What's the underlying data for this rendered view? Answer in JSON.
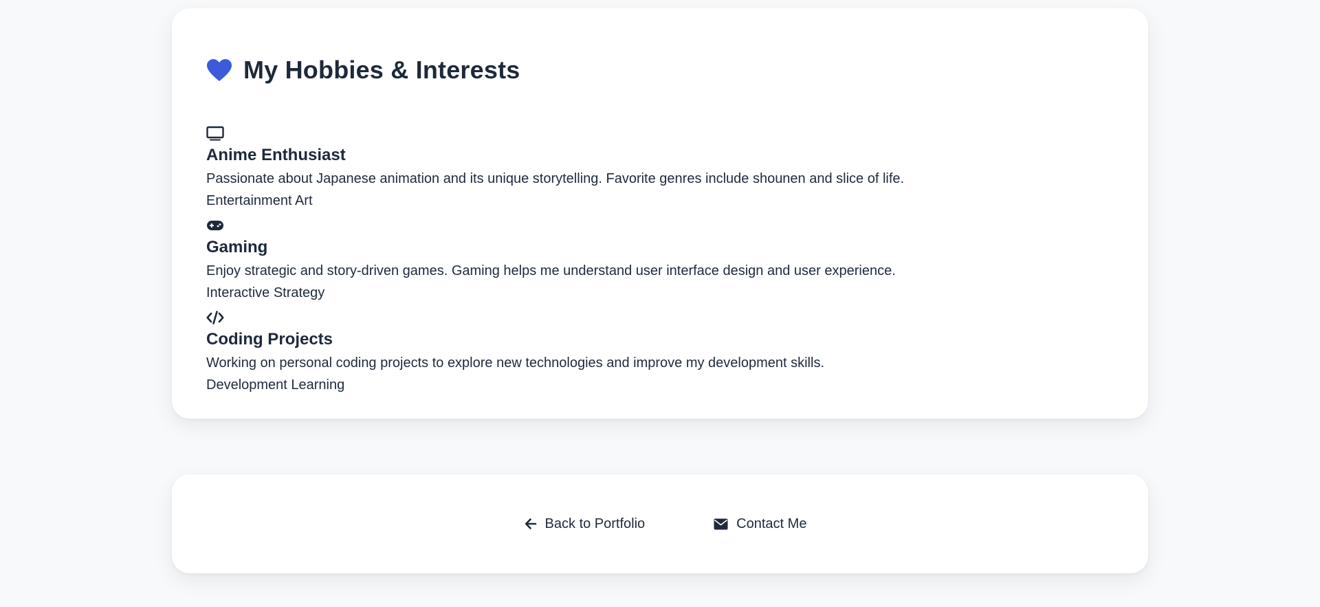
{
  "colors": {
    "accent": "#3b5bdb",
    "text": "#1e293b",
    "background": "#f8f9fb",
    "card": "#ffffff"
  },
  "hobbies_section": {
    "icon": "heart-icon",
    "title": "My Hobbies & Interests",
    "items": [
      {
        "icon": "tv-icon",
        "title": "Anime Enthusiast",
        "description": "Passionate about Japanese animation and its unique storytelling. Favorite genres include shounen and slice of life.",
        "tags": "Entertainment Art"
      },
      {
        "icon": "gamepad-icon",
        "title": "Gaming",
        "description": "Enjoy strategic and story-driven games. Gaming helps me understand user interface design and user experience.",
        "tags": "Interactive Strategy"
      },
      {
        "icon": "code-icon",
        "title": "Coding Projects",
        "description": "Working on personal coding projects to explore new technologies and improve my development skills.",
        "tags": "Development Learning"
      }
    ]
  },
  "footer": {
    "back_label": "Back to Portfolio",
    "back_icon": "arrow-left-icon",
    "contact_label": "Contact Me",
    "contact_icon": "envelope-icon"
  }
}
